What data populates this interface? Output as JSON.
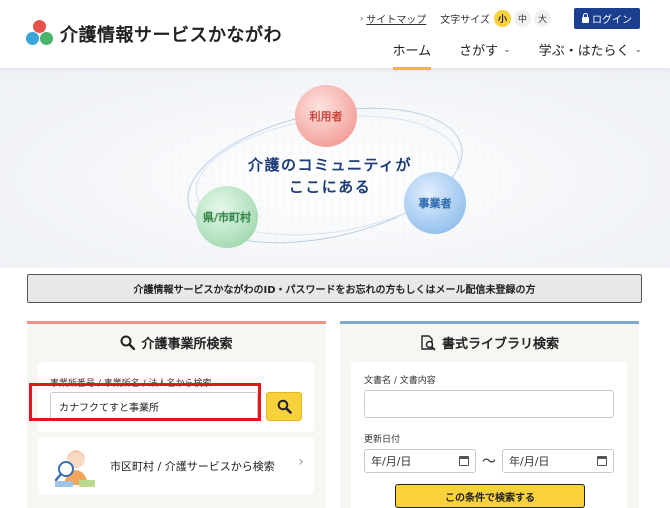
{
  "header": {
    "logo_text": "介護情報サービスかながわ",
    "sitemap_label": "サイトマップ",
    "font_size_label": "文字サイズ",
    "font_sizes": [
      "小",
      "中",
      "大"
    ],
    "login_label": "ログイン",
    "nav": [
      {
        "label": "ホーム"
      },
      {
        "label": "さがす"
      },
      {
        "label": "学ぶ・はたらく"
      }
    ]
  },
  "hero": {
    "catch_line1": "介護のコミュニティが",
    "catch_line2": "ここにある",
    "bubble_user": "利用者",
    "bubble_pref": "県/市町村",
    "bubble_biz": "事業者"
  },
  "notice": {
    "text": "介護情報サービスかながわのID・パスワードをお忘れの方もしくはメール配信未登録の方"
  },
  "facility_search": {
    "title": "介護事業所検索",
    "label": "事業所番号 / 事業所名 / 法人名から検索",
    "input_value": "カナフクてすと事業所",
    "area_link": "市区町村 / 介護サービスから検索"
  },
  "library_search": {
    "title": "書式ライブラリ検索",
    "doc_label": "文書名 / 文書内容",
    "date_label": "更新日付",
    "date_from": "年/月/日",
    "date_to": "年/月/日",
    "tilde": "～",
    "submit_label": "この条件で検索する"
  },
  "colors": {
    "accent_yellow": "#f9d23b",
    "login_navy": "#1b3e8f",
    "highlight_red": "#e8141c",
    "left_panel_border": "#ef8f88",
    "right_panel_border": "#7fa7d6"
  },
  "icons": {
    "logo": "three-circles-logo",
    "search": "magnifier-icon",
    "library": "document-search-icon",
    "calendar": "calendar-icon",
    "lock": "lock-icon"
  }
}
